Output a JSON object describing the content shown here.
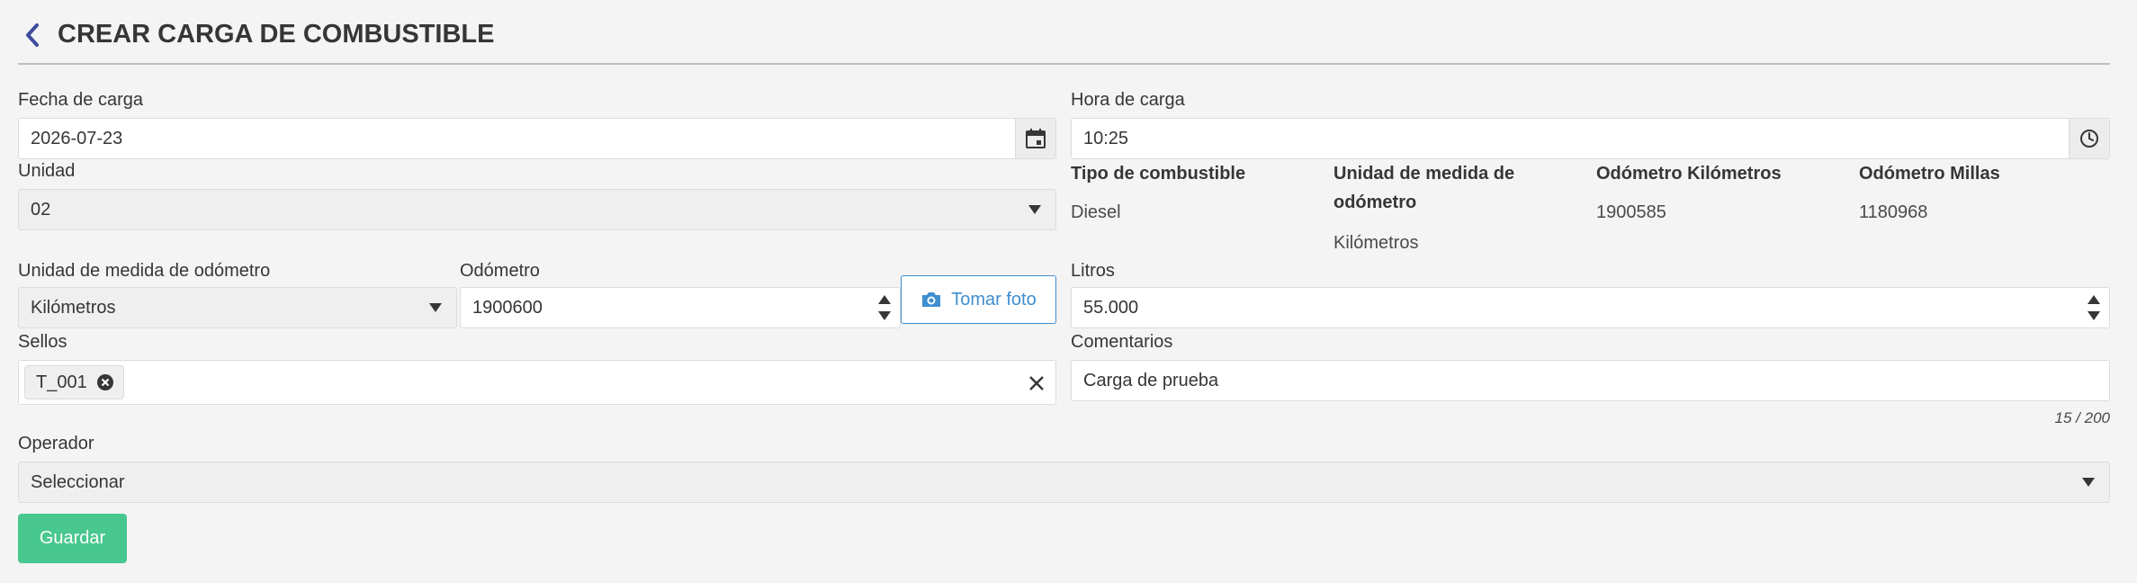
{
  "header": {
    "title": "CREAR CARGA DE COMBUSTIBLE"
  },
  "fecha": {
    "label": "Fecha de carga",
    "value": "2026-07-23"
  },
  "hora": {
    "label": "Hora de carga",
    "value": "10:25"
  },
  "unidad": {
    "label": "Unidad",
    "value": "02"
  },
  "info": {
    "tipo_label": "Tipo de combustible",
    "tipo_value": "Diesel",
    "medida_label_1": "Unidad de medida de",
    "medida_label_2": "odómetro",
    "medida_value": "Kilómetros",
    "odo_km_label": "Odómetro Kilómetros",
    "odo_km_value": "1900585",
    "odo_mi_label": "Odómetro Millas",
    "odo_mi_value": "1180968"
  },
  "medida": {
    "label": "Unidad de medida de odómetro",
    "value": "Kilómetros"
  },
  "odometro": {
    "label": "Odómetro",
    "value": "1900600"
  },
  "foto": {
    "label": "Tomar foto"
  },
  "litros": {
    "label": "Litros",
    "value": "55.000"
  },
  "sellos": {
    "label": "Sellos",
    "tags": [
      "T_001"
    ]
  },
  "comentarios": {
    "label": "Comentarios",
    "value": "Carga de prueba",
    "counter": "15 / 200"
  },
  "operador": {
    "label": "Operador",
    "value": "Seleccionar"
  },
  "guardar": {
    "label": "Guardar"
  },
  "colors": {
    "primary": "#3e8ed0",
    "success": "#48c78e",
    "back": "#3e4d9c"
  },
  "icons": [
    "chevron-left-icon",
    "calendar-icon",
    "clock-icon",
    "camera-icon",
    "close-circle-icon",
    "clear-icon"
  ]
}
